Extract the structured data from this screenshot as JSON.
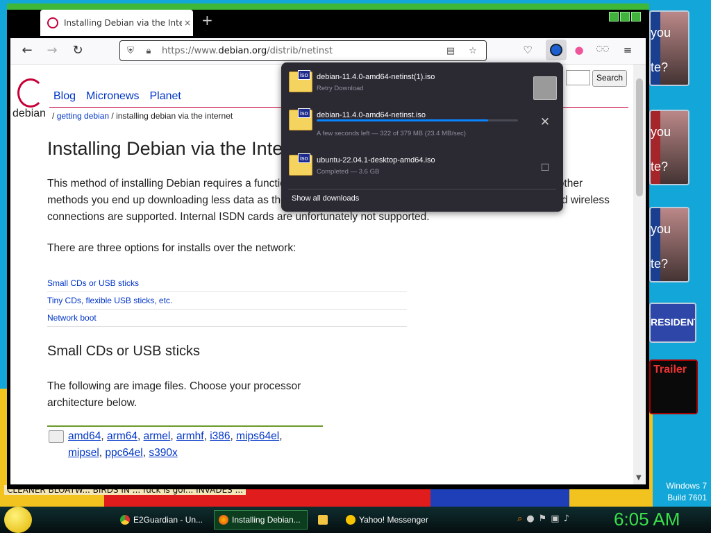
{
  "browser": {
    "tab_title": "Installing Debian via the Internet",
    "tab_close": "×",
    "new_tab": "+",
    "url_prefix": "https://www.",
    "url_domain": "debian.org",
    "url_path": "/distrib/netinst"
  },
  "page": {
    "logo_text": "debian",
    "nav": [
      "Blog",
      "Micronews",
      "Planet"
    ],
    "search_button": "Search",
    "breadcrumb_sep": "/",
    "breadcrumb_link": "getting debian",
    "breadcrumb_current": " / installing debian via the internet",
    "title": "Installing Debian via the Internet",
    "intro": "This method of installing Debian requires a functioning Internet access during the installation. Compared to other methods you end up downloading less data as the process will be tailored to your requirements. Ethernet and wireless connections are supported. Internal ISDN cards are unfortunately not supported.",
    "options_intro": "There are three options for installs over the network:",
    "toc": [
      "Small CDs or USB sticks",
      "Tiny CDs, flexible USB sticks, etc.",
      "Network boot"
    ],
    "section_title": "Small CDs or USB sticks",
    "section_text": "The following are image files. Choose your processor architecture below.",
    "archs": [
      "amd64",
      "arm64",
      "armel",
      "armhf",
      "i386",
      "mips64el",
      "mipsel",
      "ppc64el",
      "s390x"
    ]
  },
  "downloads": {
    "items": [
      {
        "name": "debian-11.4.0-amd64-netinst(1).iso",
        "status": "Retry Download"
      },
      {
        "name": "debian-11.4.0-amd64-netinst.iso",
        "status": "A few seconds left — 322 of 379 MB (23.4 MB/sec)",
        "progress": 0.85
      },
      {
        "name": "ubuntu-22.04.1-desktop-amd64.iso",
        "status": "Completed — 3.6 GB"
      }
    ],
    "file_icon_label": "iso",
    "show_all": "Show all downloads"
  },
  "desktop": {
    "ad_texts": [
      "you",
      "te?",
      "you",
      "te?",
      "you",
      "te?",
      "RESIDENT",
      "Trailer"
    ],
    "news_ticker": "CLEANER   BLOATW...   BIRDS IN ...   fuck is goi...   INVADES ...",
    "windows_line1": "Windows 7",
    "windows_line2": "Build 7601"
  },
  "taskbar": {
    "items": [
      "E2Guardian - Un...",
      "Installing Debian...",
      "Yahoo! Messenger"
    ],
    "clock": "6:05 AM"
  },
  "colors": {
    "accent": "#0a84ff",
    "debian_red": "#c70036",
    "clock_green": "#3ae04a"
  },
  "icons": [
    "back-icon",
    "forward-icon",
    "reload-icon",
    "shield-icon",
    "lock-icon",
    "reader-icon",
    "star-icon",
    "pocket-icon",
    "download-icon",
    "menu-icon",
    "close-icon",
    "folder-icon"
  ]
}
